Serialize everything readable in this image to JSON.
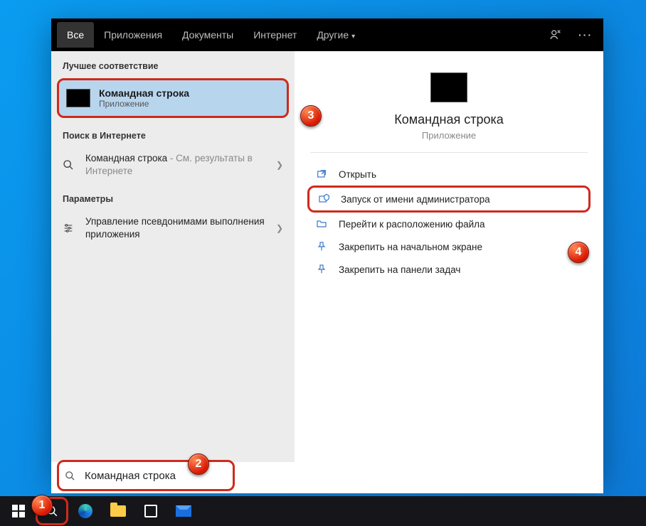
{
  "tabs": {
    "all": "Все",
    "apps": "Приложения",
    "docs": "Документы",
    "web": "Интернет",
    "other": "Другие"
  },
  "sections": {
    "best_match": "Лучшее соответствие",
    "web_search": "Поиск в Интернете",
    "settings": "Параметры"
  },
  "best_match": {
    "title": "Командная строка",
    "subtitle": "Приложение"
  },
  "web_result": {
    "prefix": "Командная строка",
    "suffix": " - См. результаты в Интернете"
  },
  "settings_result": "Управление псевдонимами выполнения приложения",
  "preview": {
    "title": "Командная строка",
    "subtitle": "Приложение"
  },
  "actions": {
    "open": "Открыть",
    "run_admin": "Запуск от имени администратора",
    "file_location": "Перейти к расположению файла",
    "pin_start": "Закрепить на начальном экране",
    "pin_taskbar": "Закрепить на панели задач"
  },
  "search": {
    "value": "Командная строка"
  },
  "badges": {
    "b1": "1",
    "b2": "2",
    "b3": "3",
    "b4": "4"
  }
}
